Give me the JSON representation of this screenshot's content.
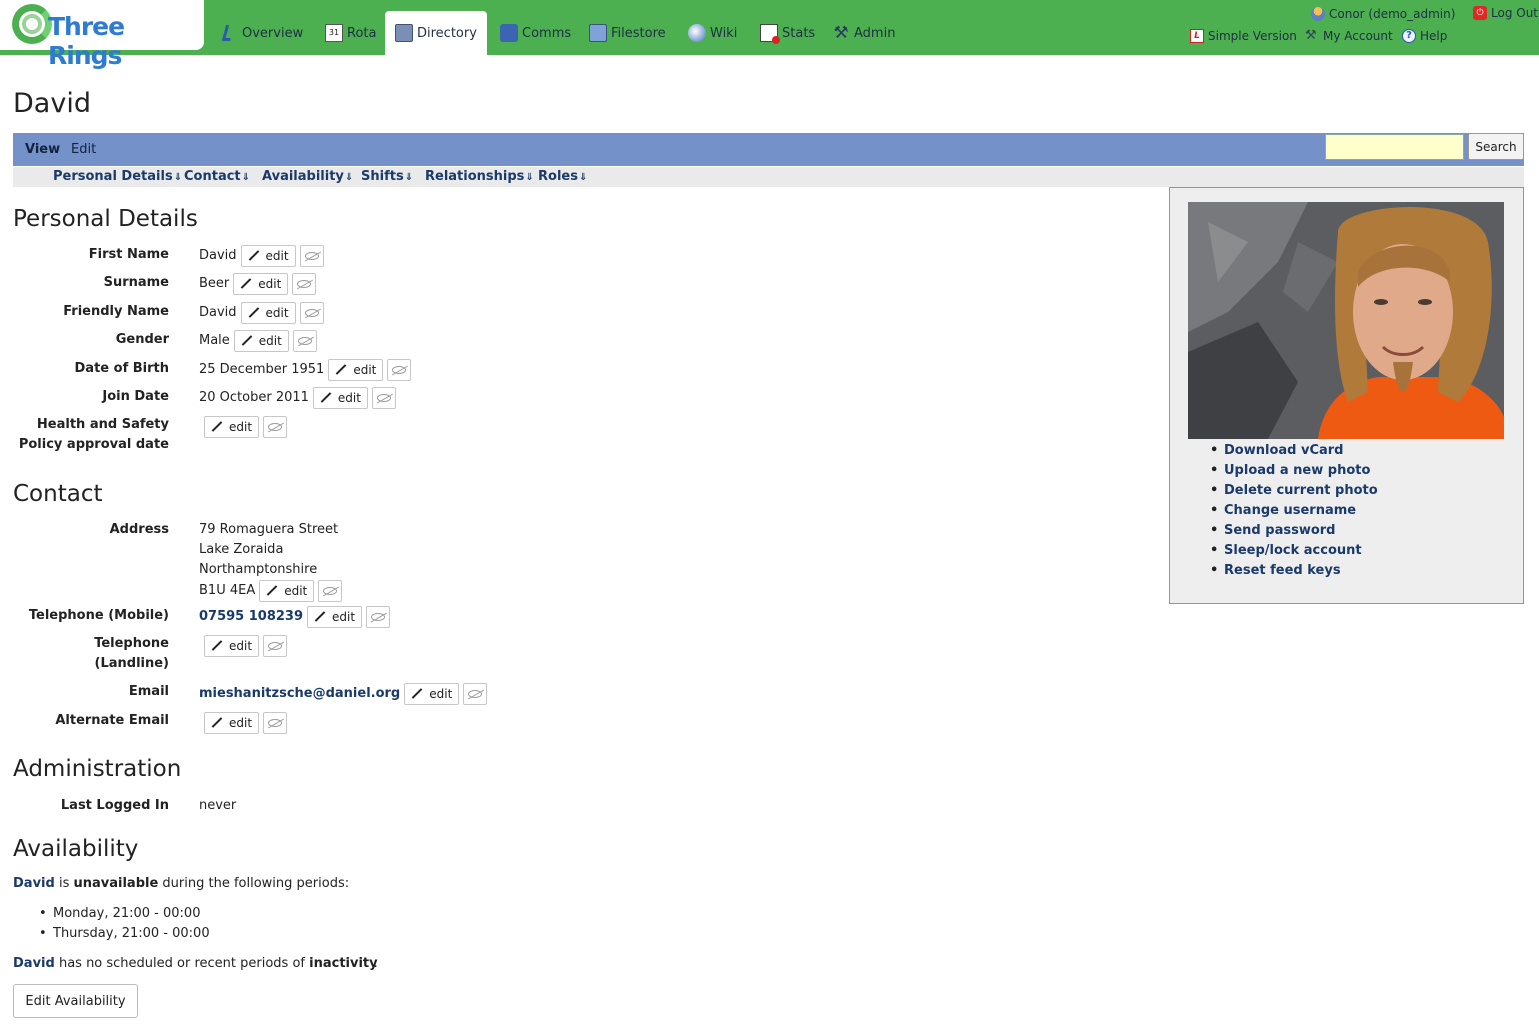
{
  "header": {
    "logo_text": "Three Rings",
    "nav": [
      {
        "label": "Overview",
        "icon": "overview-icon"
      },
      {
        "label": "Rota",
        "icon": "calendar-icon"
      },
      {
        "label": "Directory",
        "icon": "directory-icon",
        "active": true
      },
      {
        "label": "Comms",
        "icon": "comms-icon"
      },
      {
        "label": "Filestore",
        "icon": "filestore-icon"
      },
      {
        "label": "Wiki",
        "icon": "globe-icon"
      },
      {
        "label": "Stats",
        "icon": "stats-icon"
      },
      {
        "label": "Admin",
        "icon": "tools-icon"
      }
    ],
    "user_label": "Conor (demo_admin)",
    "logout_label": "Log Out",
    "simple_version_label": "Simple Version",
    "my_account_label": "My Account",
    "help_label": "Help",
    "rota_icon_text": "31"
  },
  "page": {
    "title": "David",
    "tabs": {
      "view": "View",
      "edit": "Edit"
    },
    "search": {
      "value": "",
      "button_label": "Search"
    },
    "anchors": [
      "Personal Details",
      "Contact",
      "Availability",
      "Shifts",
      "Relationships",
      "Roles"
    ]
  },
  "personal_details": {
    "heading": "Personal Details",
    "edit_label": "edit",
    "fields": [
      {
        "label": "First Name",
        "value": "David"
      },
      {
        "label": "Surname",
        "value": "Beer"
      },
      {
        "label": "Friendly Name",
        "value": "David"
      },
      {
        "label": "Gender",
        "value": "Male"
      },
      {
        "label": "Date of Birth",
        "value": "25 December 1951"
      },
      {
        "label": "Join Date",
        "value": "20 October 2011"
      },
      {
        "label_line1": "Health and Safety",
        "label_line2": "Policy approval date",
        "value": ""
      }
    ]
  },
  "contact": {
    "heading": "Contact",
    "address_label": "Address",
    "address_lines": [
      "79 Romaguera Street",
      "Lake Zoraida",
      "Northamptonshire",
      "B1U 4EA"
    ],
    "mobile_label": "Telephone (Mobile)",
    "mobile_value": "07595 108239",
    "landline_label_line1": "Telephone",
    "landline_label_line2": "(Landline)",
    "email_label": "Email",
    "email_value": "mieshanitzsche@daniel.org",
    "alt_email_label": "Alternate Email"
  },
  "administration": {
    "heading": "Administration",
    "last_logged_in_label": "Last Logged In",
    "last_logged_in_value": "never"
  },
  "availability": {
    "heading": "Availability",
    "name": "David",
    "text_is": "is",
    "text_unavailable": "unavailable",
    "text_during": "during the following periods:",
    "periods": [
      "Monday, 21:00 - 00:00",
      "Thursday, 21:00 - 00:00"
    ],
    "text_has_no": "has no scheduled or recent periods of",
    "text_inactivity": "inactivity",
    "text_period": ".",
    "edit_button_label": "Edit Availability"
  },
  "side_panel": {
    "links": [
      "Download vCard",
      "Upload a new photo",
      "Delete current photo",
      "Change username",
      "Send password",
      "Sleep/lock account",
      "Reset feed keys"
    ]
  }
}
